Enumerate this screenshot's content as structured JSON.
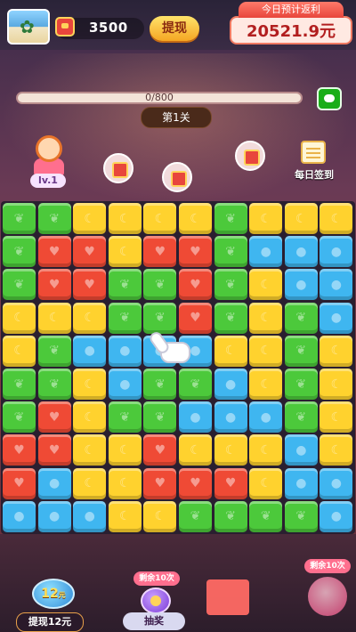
{
  "header": {
    "coins": "3500",
    "withdraw_label": "提现",
    "rebate_title": "今日预计返利",
    "rebate_amount": "20521.9元"
  },
  "progress": {
    "text": "0/800",
    "fraction": 0.0
  },
  "level": {
    "label": "第1关"
  },
  "character": {
    "level_label": "lv.1"
  },
  "daily": {
    "label": "每日签到"
  },
  "icons": {
    "avatar": "beach-photo",
    "coin": "red-envelope-icon",
    "chat": "wechat-icon",
    "bubble": "red-envelope-bubble-icon",
    "daily": "calendar-icon",
    "hand": "pointer-hand-icon",
    "lottery": "lottery-icon"
  },
  "colors": {
    "green": "#4cc93b",
    "red": "#ef4a35",
    "yellow": "#ffd22e",
    "blue": "#3fb6f0"
  },
  "board": {
    "rows": [
      [
        "G",
        "G",
        "Y",
        "Y",
        "Y",
        "Y",
        "G",
        "Y",
        "Y",
        "Y"
      ],
      [
        "G",
        "R",
        "R",
        "Y",
        "R",
        "R",
        "G",
        "B",
        "B",
        "B"
      ],
      [
        "G",
        "R",
        "R",
        "G",
        "G",
        "R",
        "G",
        "Y",
        "B",
        "B"
      ],
      [
        "Y",
        "Y",
        "Y",
        "G",
        "G",
        "R",
        "G",
        "Y",
        "G",
        "B"
      ],
      [
        "Y",
        "G",
        "B",
        "B",
        "B",
        "B",
        "Y",
        "Y",
        "G",
        "Y"
      ],
      [
        "G",
        "G",
        "Y",
        "B",
        "G",
        "G",
        "B",
        "Y",
        "G",
        "Y"
      ],
      [
        "G",
        "R",
        "Y",
        "G",
        "G",
        "B",
        "B",
        "B",
        "G",
        "Y"
      ],
      [
        "R",
        "R",
        "Y",
        "Y",
        "R",
        "Y",
        "Y",
        "Y",
        "B",
        "Y"
      ],
      [
        "R",
        "B",
        "Y",
        "Y",
        "R",
        "R",
        "R",
        "Y",
        "B",
        "B"
      ],
      [
        "B",
        "B",
        "B",
        "Y",
        "Y",
        "G",
        "G",
        "G",
        "G",
        "B"
      ]
    ]
  },
  "bottom": {
    "prize_amount": "12",
    "prize_unit": "元",
    "withdraw12_label": "提现12元",
    "remain_left": "剩余10次",
    "lottery_label": "抽奖",
    "remain_right": "剩余10次"
  }
}
